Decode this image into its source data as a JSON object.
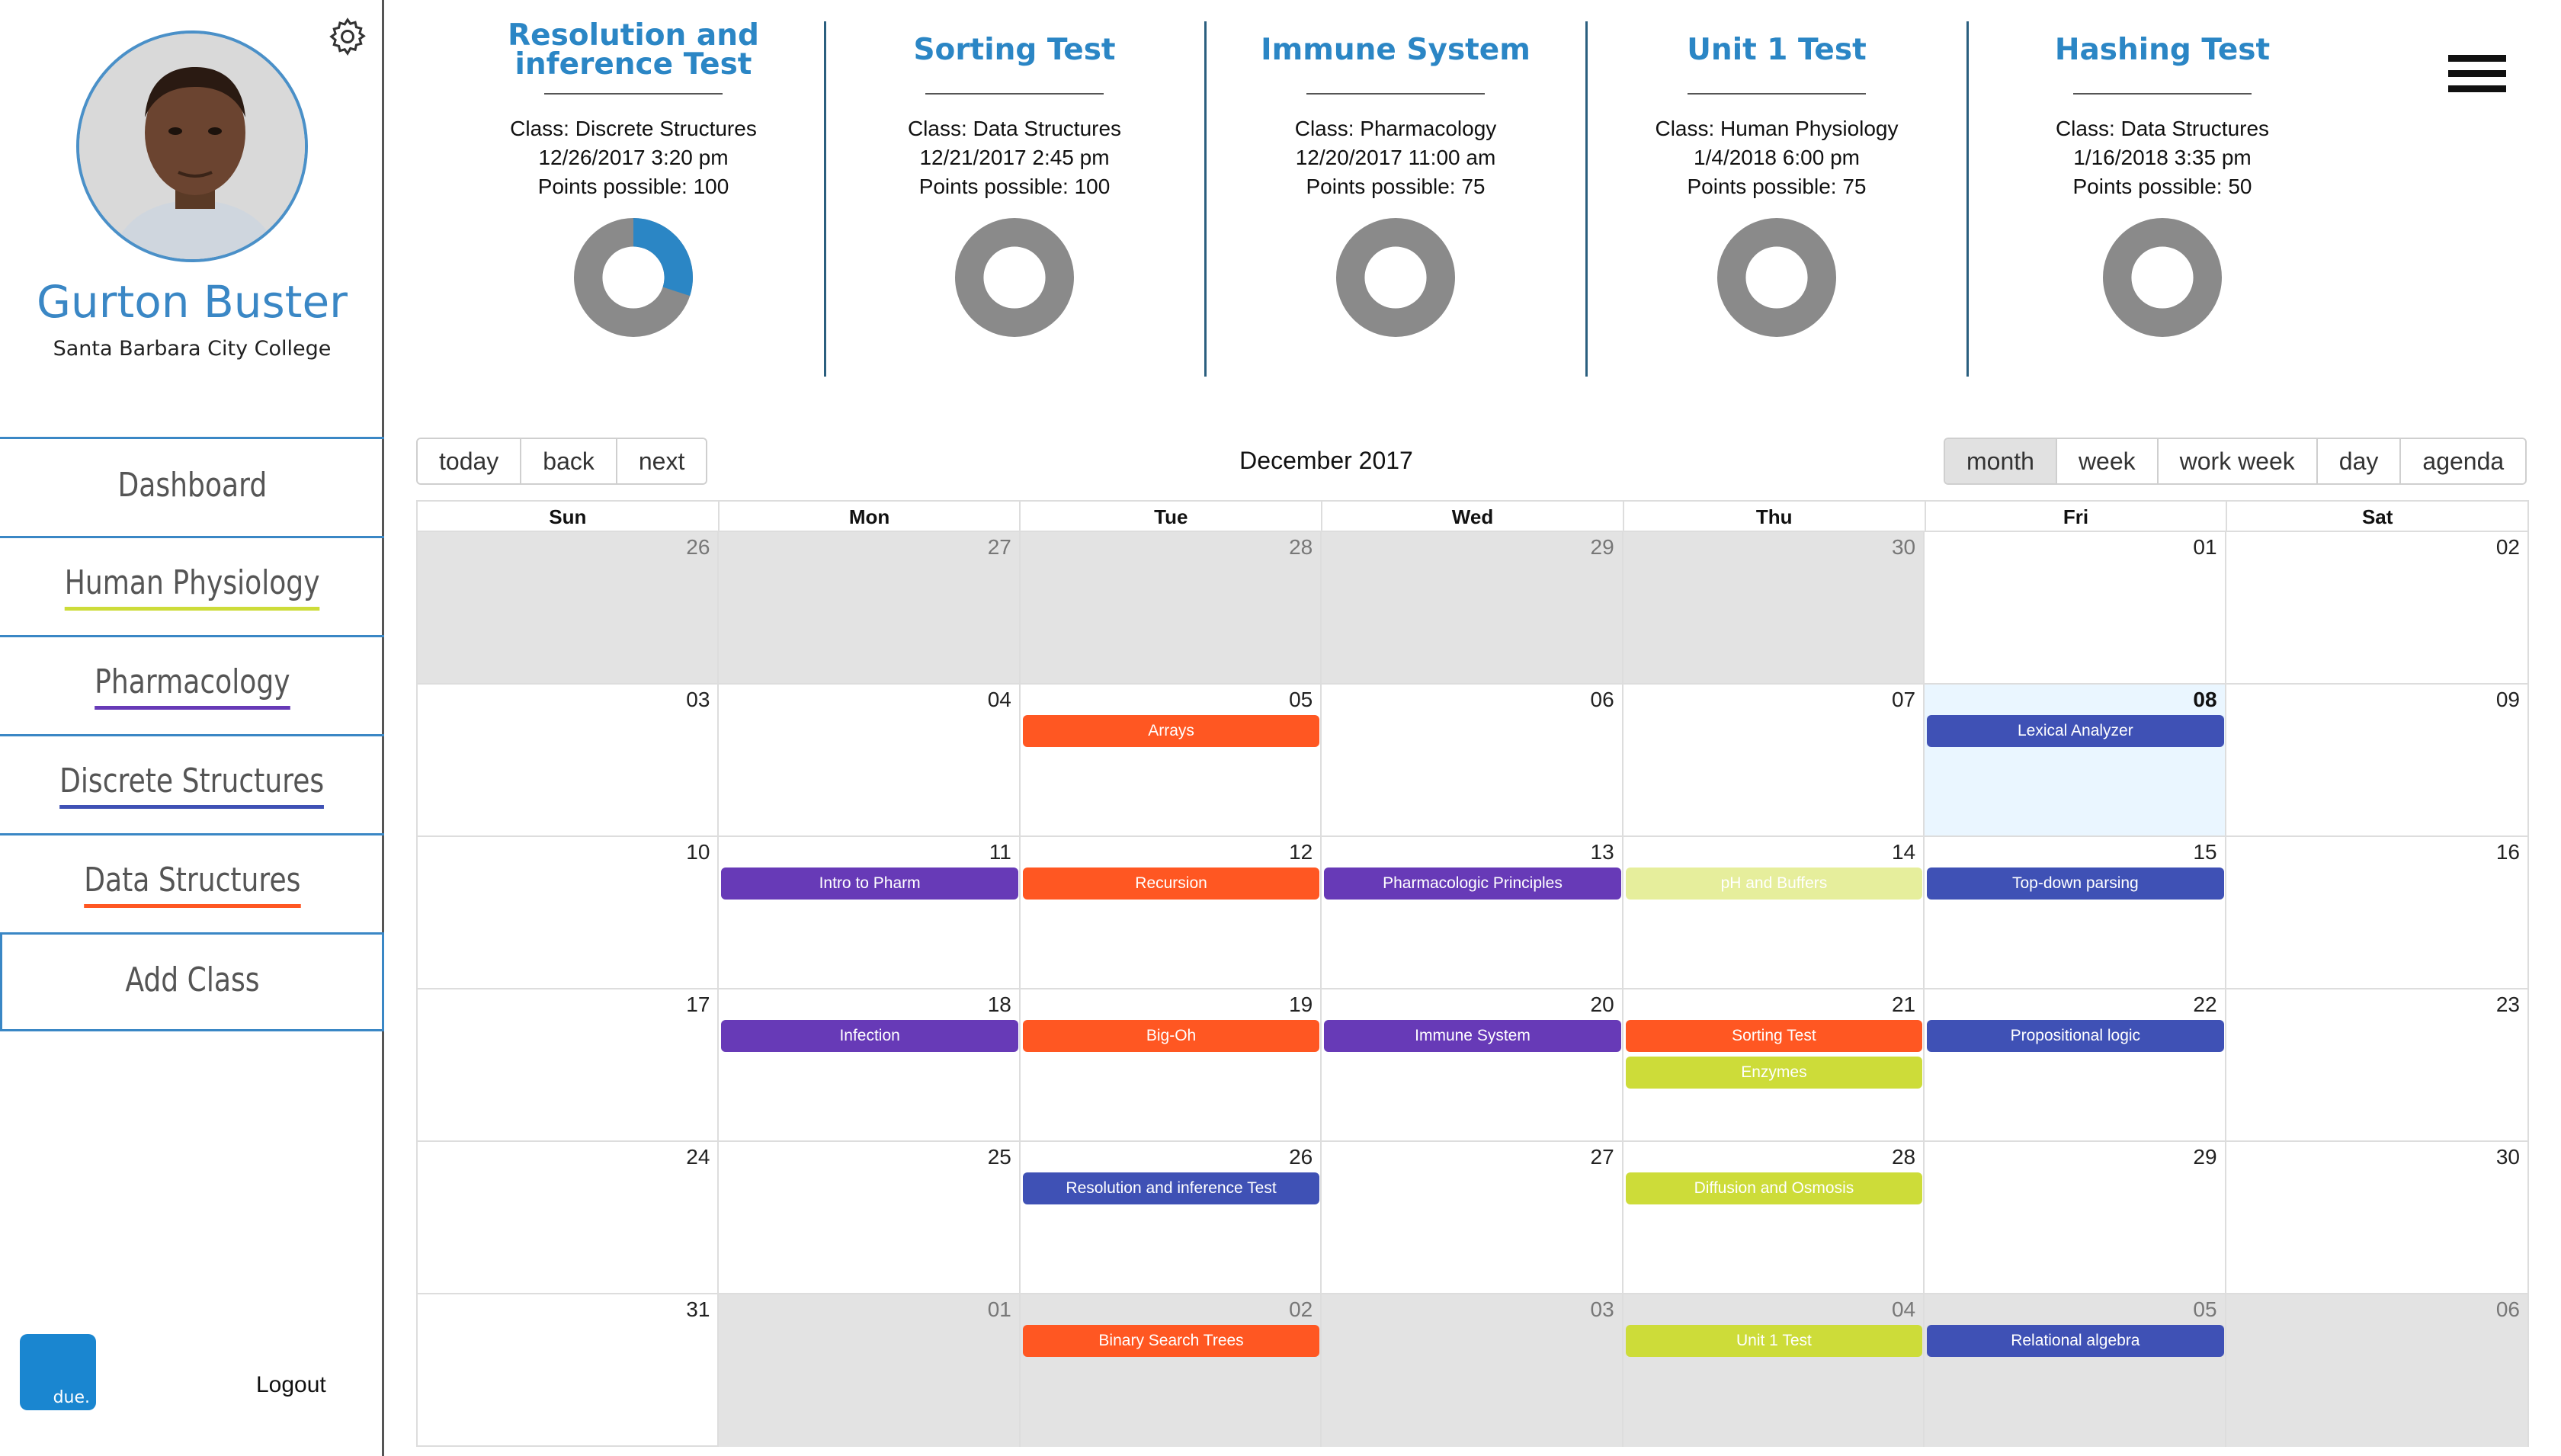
{
  "profile": {
    "name": "Gurton Buster",
    "school": "Santa Barbara City College"
  },
  "nav": [
    {
      "label": "Dashboard",
      "underline": ""
    },
    {
      "label": "Human Physiology",
      "underline": "#cddc39"
    },
    {
      "label": "Pharmacology",
      "underline": "#673ab7"
    },
    {
      "label": "Discrete Structures",
      "underline": "#3f51b5"
    },
    {
      "label": "Data Structures",
      "underline": "#ff5722"
    },
    {
      "label": "Add Class",
      "underline": ""
    }
  ],
  "logo_text": "due.",
  "logout_label": "Logout",
  "tests": [
    {
      "title": "Resolution and inference Test",
      "class": "Class: Discrete Structures",
      "datetime": "12/26/2017 3:20 pm",
      "points": "Points possible: 100",
      "progress": 0.3
    },
    {
      "title": "Sorting Test",
      "class": "Class: Data Structures",
      "datetime": "12/21/2017 2:45 pm",
      "points": "Points possible: 100",
      "progress": 0
    },
    {
      "title": "Immune System",
      "class": "Class: Pharmacology",
      "datetime": "12/20/2017 11:00 am",
      "points": "Points possible: 75",
      "progress": 0
    },
    {
      "title": "Unit 1 Test",
      "class": "Class: Human Physiology",
      "datetime": "1/4/2018 6:00 pm",
      "points": "Points possible: 75",
      "progress": 0
    },
    {
      "title": "Hashing Test",
      "class": "Class: Data Structures",
      "datetime": "1/16/2018 3:35 pm",
      "points": "Points possible: 50",
      "progress": 0
    }
  ],
  "colors": {
    "brand": "#2b86c5",
    "human_physiology": "#cddc39",
    "pharmacology": "#673ab7",
    "discrete_structures": "#3f51b5",
    "data_structures": "#ff5722",
    "donut_track": "#8a8a8a",
    "donut_fill": "#2b86c5"
  },
  "calendar": {
    "label": "December 2017",
    "nav_buttons": [
      "today",
      "back",
      "next"
    ],
    "view_buttons": [
      "month",
      "week",
      "work week",
      "day",
      "agenda"
    ],
    "active_view": "month",
    "day_headers": [
      "Sun",
      "Mon",
      "Tue",
      "Wed",
      "Thu",
      "Fri",
      "Sat"
    ],
    "weeks": [
      [
        {
          "d": "26",
          "off": true
        },
        {
          "d": "27",
          "off": true
        },
        {
          "d": "28",
          "off": true
        },
        {
          "d": "29",
          "off": true
        },
        {
          "d": "30",
          "off": true
        },
        {
          "d": "01"
        },
        {
          "d": "02"
        }
      ],
      [
        {
          "d": "03"
        },
        {
          "d": "04"
        },
        {
          "d": "05"
        },
        {
          "d": "06"
        },
        {
          "d": "07"
        },
        {
          "d": "08",
          "today": true
        },
        {
          "d": "09"
        }
      ],
      [
        {
          "d": "10"
        },
        {
          "d": "11"
        },
        {
          "d": "12"
        },
        {
          "d": "13"
        },
        {
          "d": "14"
        },
        {
          "d": "15"
        },
        {
          "d": "16"
        }
      ],
      [
        {
          "d": "17"
        },
        {
          "d": "18"
        },
        {
          "d": "19"
        },
        {
          "d": "20"
        },
        {
          "d": "21"
        },
        {
          "d": "22"
        },
        {
          "d": "23"
        }
      ],
      [
        {
          "d": "24"
        },
        {
          "d": "25"
        },
        {
          "d": "26"
        },
        {
          "d": "27"
        },
        {
          "d": "28"
        },
        {
          "d": "29"
        },
        {
          "d": "30"
        }
      ],
      [
        {
          "d": "31"
        },
        {
          "d": "01",
          "off": true
        },
        {
          "d": "02",
          "off": true
        },
        {
          "d": "03",
          "off": true
        },
        {
          "d": "04",
          "off": true
        },
        {
          "d": "05",
          "off": true
        },
        {
          "d": "06",
          "off": true
        }
      ]
    ],
    "events": [
      {
        "title": "Arrays",
        "week": 1,
        "day": 2,
        "slot": 0,
        "color": "#ff5722"
      },
      {
        "title": "Lexical Analyzer",
        "week": 1,
        "day": 5,
        "slot": 0,
        "color": "#3f51b5"
      },
      {
        "title": "Intro to Pharm",
        "week": 2,
        "day": 1,
        "slot": 0,
        "color": "#673ab7"
      },
      {
        "title": "Recursion",
        "week": 2,
        "day": 2,
        "slot": 0,
        "color": "#ff5722"
      },
      {
        "title": "Pharmacologic Principles",
        "week": 2,
        "day": 3,
        "slot": 0,
        "color": "#673ab7"
      },
      {
        "title": "pH and Buffers",
        "week": 2,
        "day": 4,
        "slot": 0,
        "color": "#e6ee9c"
      },
      {
        "title": "Top-down parsing",
        "week": 2,
        "day": 5,
        "slot": 0,
        "color": "#3f51b5"
      },
      {
        "title": "Infection",
        "week": 3,
        "day": 1,
        "slot": 0,
        "color": "#673ab7"
      },
      {
        "title": "Big-Oh",
        "week": 3,
        "day": 2,
        "slot": 0,
        "color": "#ff5722"
      },
      {
        "title": "Immune System",
        "week": 3,
        "day": 3,
        "slot": 0,
        "color": "#673ab7"
      },
      {
        "title": "Sorting Test",
        "week": 3,
        "day": 4,
        "slot": 0,
        "color": "#ff5722"
      },
      {
        "title": "Enzymes",
        "week": 3,
        "day": 4,
        "slot": 1,
        "color": "#cddc39"
      },
      {
        "title": "Propositional logic",
        "week": 3,
        "day": 5,
        "slot": 0,
        "color": "#3f51b5"
      },
      {
        "title": "Resolution and inference Test",
        "week": 4,
        "day": 2,
        "slot": 0,
        "color": "#3f51b5"
      },
      {
        "title": "Diffusion and Osmosis",
        "week": 4,
        "day": 4,
        "slot": 0,
        "color": "#cddc39"
      },
      {
        "title": "Binary Search Trees",
        "week": 5,
        "day": 2,
        "slot": 0,
        "color": "#ff5722"
      },
      {
        "title": "Unit 1 Test",
        "week": 5,
        "day": 4,
        "slot": 0,
        "color": "#cddc39"
      },
      {
        "title": "Relational algebra",
        "week": 5,
        "day": 5,
        "slot": 0,
        "color": "#3f51b5"
      }
    ]
  }
}
